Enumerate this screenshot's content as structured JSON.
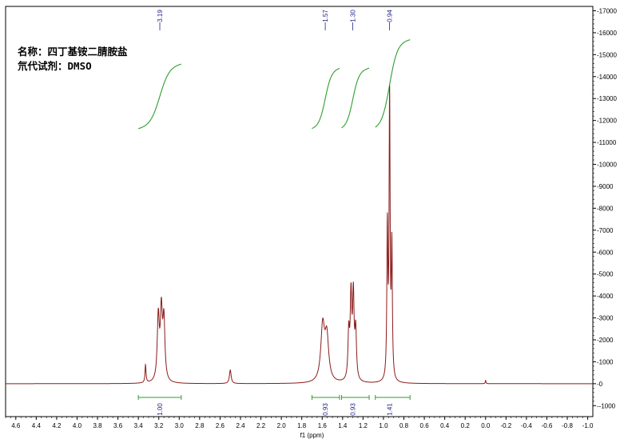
{
  "info": {
    "name_label": "名称：",
    "name_value": "四丁基铵二腈胺盐",
    "solvent_label": "氘代试剂：",
    "solvent_value": "DMSO"
  },
  "colors": {
    "spectrum": "#8b1a1a",
    "integral": "#2e9e2e",
    "peak_label": "#1f1f8c",
    "axis": "#000000"
  },
  "chart_data": {
    "type": "line",
    "xlabel": "f1 (ppm)",
    "ylabel": "",
    "xlim": [
      4.7,
      -1.05
    ],
    "ylim": [
      -1500,
      17200
    ],
    "x_reversed": true,
    "y_axis_side": "right",
    "x_ticks": [
      4.6,
      4.4,
      4.2,
      4.0,
      3.8,
      3.6,
      3.4,
      3.2,
      3.0,
      2.8,
      2.6,
      2.4,
      2.2,
      2.0,
      1.8,
      1.6,
      1.4,
      1.2,
      1.0,
      0.8,
      0.6,
      0.4,
      0.2,
      0.0,
      -0.2,
      -0.4,
      -0.6,
      -0.8,
      -1.0
    ],
    "x_tick_labels": [
      "4.6",
      "4.4",
      "4.2",
      "4.0",
      "3.8",
      "3.6",
      "3.4",
      "3.2",
      "3.0",
      "2.8",
      "2.6",
      "2.4",
      "2.2",
      "2.0",
      "1.8",
      "1.6",
      "1.4",
      "1.2",
      "1.0",
      "0.8",
      "0.6",
      "0.4",
      "0.2",
      "0.0",
      "-0.2",
      "-0.4",
      "-0.6",
      "-0.8",
      "-1.0"
    ],
    "y_ticks": [
      -1000,
      0,
      1000,
      2000,
      3000,
      4000,
      5000,
      6000,
      7000,
      8000,
      9000,
      10000,
      11000,
      12000,
      13000,
      14000,
      15000,
      16000,
      17000
    ],
    "y_tick_labels": [
      "--1000",
      "-0",
      "-1000",
      "-2000",
      "-3000",
      "-4000",
      "-5000",
      "-6000",
      "-7000",
      "-8000",
      "-9000",
      "-10000",
      "-11000",
      "-12000",
      "-13000",
      "-14000",
      "-15000",
      "-16000",
      "-17000"
    ],
    "peak_labels": [
      {
        "ppm": 3.19,
        "label": "3.19"
      },
      {
        "ppm": 1.57,
        "label": "1.57"
      },
      {
        "ppm": 1.3,
        "label": "1.30"
      },
      {
        "ppm": 0.94,
        "label": "0.94"
      }
    ],
    "peaks": [
      {
        "ppm": 3.33,
        "height": 820,
        "width": 0.006
      },
      {
        "ppm": 3.205,
        "height": 2900,
        "width": 0.012
      },
      {
        "ppm": 3.175,
        "height": 3050,
        "width": 0.012
      },
      {
        "ppm": 3.15,
        "height": 2700,
        "width": 0.012
      },
      {
        "ppm": 2.5,
        "height": 620,
        "width": 0.01
      },
      {
        "ppm": 1.595,
        "height": 2500,
        "width": 0.022
      },
      {
        "ppm": 1.555,
        "height": 2000,
        "width": 0.022
      },
      {
        "ppm": 1.34,
        "height": 2100,
        "width": 0.009
      },
      {
        "ppm": 1.318,
        "height": 3700,
        "width": 0.009
      },
      {
        "ppm": 1.295,
        "height": 3750,
        "width": 0.009
      },
      {
        "ppm": 1.272,
        "height": 2200,
        "width": 0.009
      },
      {
        "ppm": 0.962,
        "height": 6800,
        "width": 0.006
      },
      {
        "ppm": 0.94,
        "height": 12800,
        "width": 0.006
      },
      {
        "ppm": 0.918,
        "height": 5900,
        "width": 0.006
      },
      {
        "ppm": 0.0,
        "height": 150,
        "width": 0.004
      }
    ],
    "integrals": [
      {
        "from": 3.4,
        "to": 2.98,
        "label": "1.00",
        "center": 3.19
      },
      {
        "from": 1.7,
        "to": 1.43,
        "label": "0.93",
        "center": 1.57
      },
      {
        "from": 1.41,
        "to": 1.14,
        "label": "0.93",
        "center": 1.3
      },
      {
        "from": 1.08,
        "to": 0.74,
        "label": "1.41",
        "center": 0.94
      }
    ]
  }
}
